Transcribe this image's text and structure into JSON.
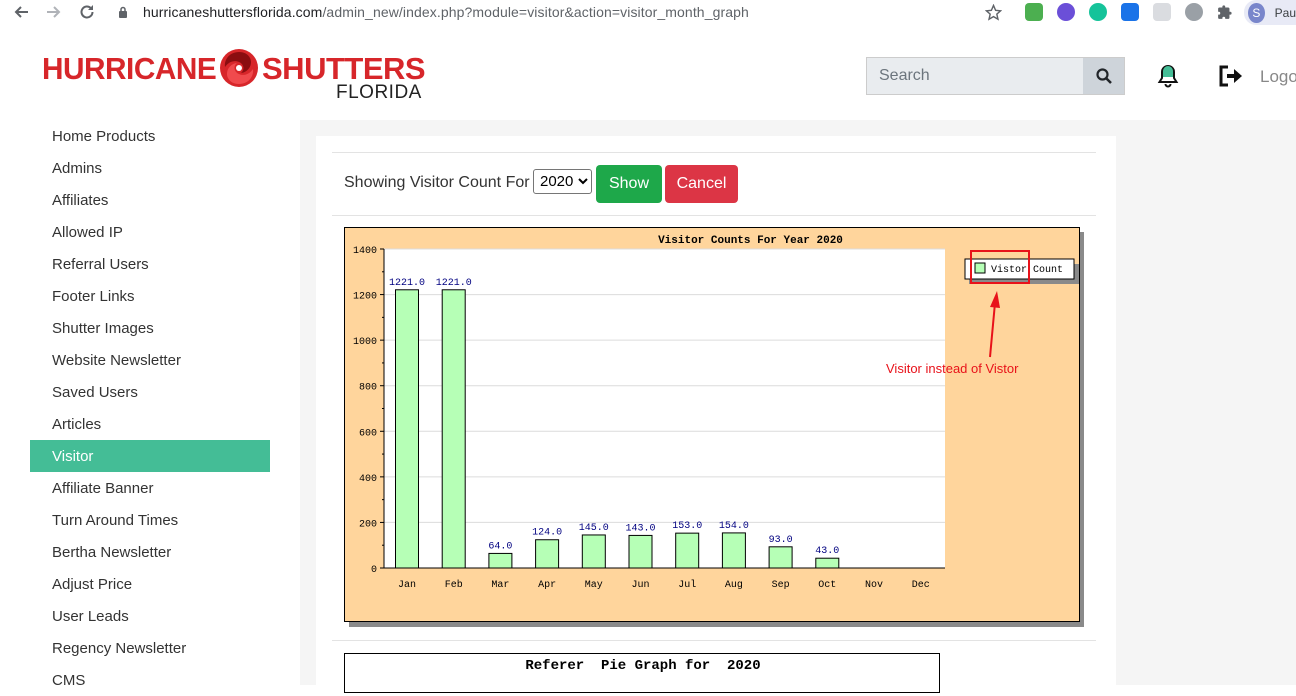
{
  "browser": {
    "url_host": "hurricaneshuttersflorida.com",
    "url_path": "/admin_new/index.php?module=visitor&action=visitor_month_graph",
    "profile_initial": "S",
    "profile_name": "Pau"
  },
  "header": {
    "logo_word1": "HURRICANE",
    "logo_word2": "SHUTTERS",
    "logo_word3": "FLORIDA",
    "search_placeholder": "Search",
    "logout_label": "Logo"
  },
  "sidebar": {
    "items": [
      {
        "label": "Home Products"
      },
      {
        "label": "Admins"
      },
      {
        "label": "Affiliates"
      },
      {
        "label": "Allowed IP"
      },
      {
        "label": "Referral Users"
      },
      {
        "label": "Footer Links"
      },
      {
        "label": "Shutter Images"
      },
      {
        "label": "Website Newsletter"
      },
      {
        "label": "Saved Users"
      },
      {
        "label": "Articles"
      },
      {
        "label": "Visitor",
        "active": true
      },
      {
        "label": "Affiliate Banner"
      },
      {
        "label": "Turn Around Times"
      },
      {
        "label": "Bertha Newsletter"
      },
      {
        "label": "Adjust Price"
      },
      {
        "label": "User Leads"
      },
      {
        "label": "Regency Newsletter"
      },
      {
        "label": "CMS"
      }
    ]
  },
  "filter": {
    "label": "Showing Visitor Count For",
    "year_selected": "2020",
    "show_label": "Show",
    "cancel_label": "Cancel"
  },
  "annotation": {
    "text": "Visitor instead of Vistor"
  },
  "pie": {
    "title": "Referer  Pie Graph for  2020"
  },
  "colors": {
    "accent": "#44bd96",
    "show": "#1ea84a",
    "cancel": "#dc3545",
    "chart_bg": "#ffd59c",
    "bar_fill": "#b6ffb6",
    "annotation": "#e8121a",
    "brand_red": "#d7262a"
  },
  "chart_data": {
    "type": "bar",
    "title": "Visitor Counts For Year 2020",
    "categories": [
      "Jan",
      "Feb",
      "Mar",
      "Apr",
      "May",
      "Jun",
      "Jul",
      "Aug",
      "Sep",
      "Oct",
      "Nov",
      "Dec"
    ],
    "series": [
      {
        "name": "Vistor Count",
        "values": [
          1221,
          1221,
          64,
          124,
          145,
          143,
          153,
          154,
          93,
          43,
          0,
          0
        ],
        "labels": [
          "1221.0",
          "1221.0",
          "64.0",
          "124.0",
          "145.0",
          "143.0",
          "153.0",
          "154.0",
          "93.0",
          "43.0",
          "",
          ""
        ]
      }
    ],
    "yticks": [
      "0",
      "200",
      "400",
      "600",
      "800",
      "1000",
      "1200",
      "1400"
    ],
    "ylim": [
      0,
      1400
    ],
    "grid": true,
    "legend_placement": "top-right"
  }
}
